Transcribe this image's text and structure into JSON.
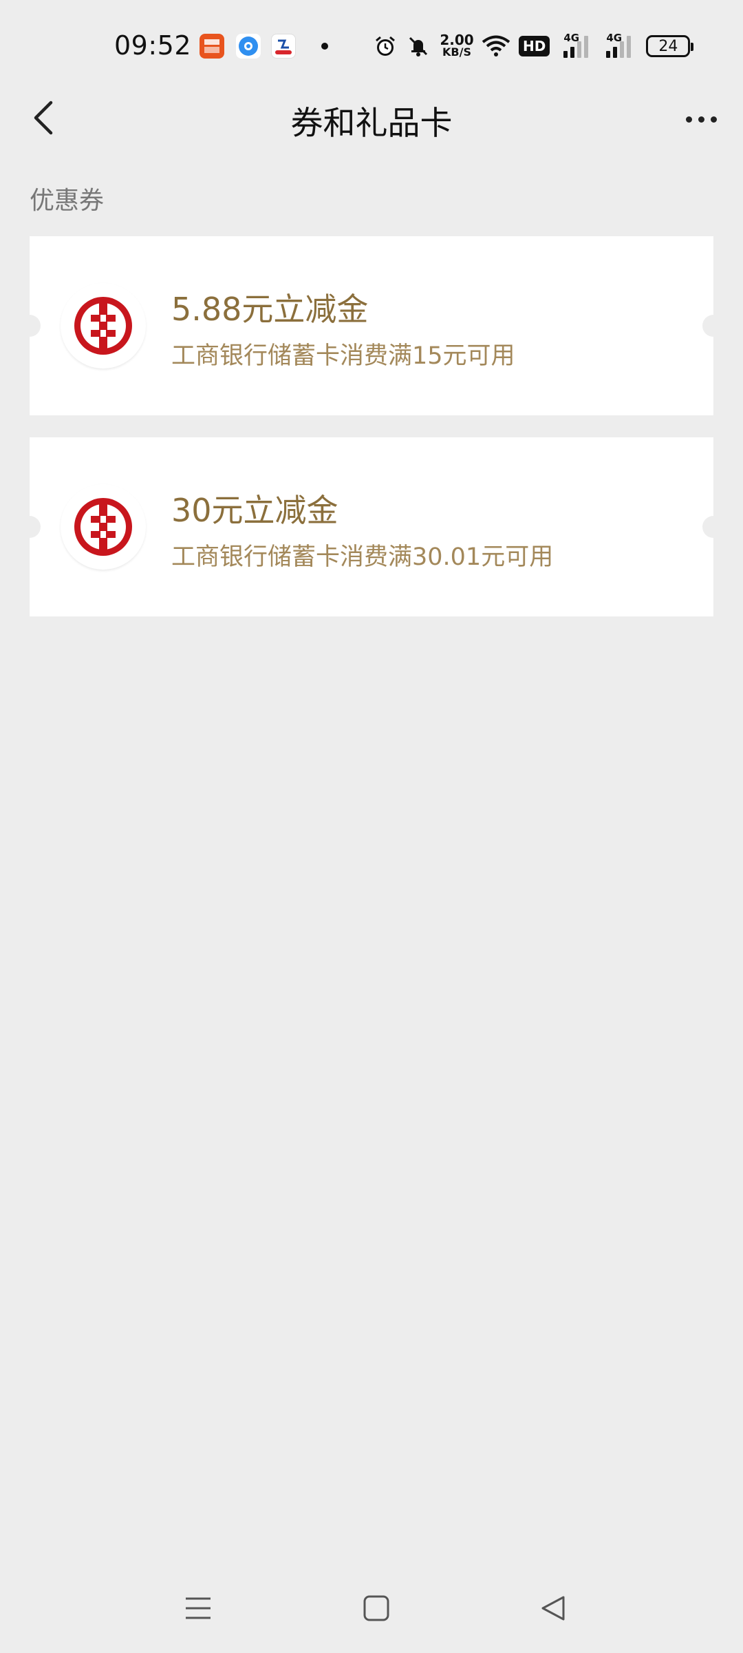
{
  "status_bar": {
    "time": "09:52",
    "net_speed_value": "2.00",
    "net_speed_unit": "KB/S",
    "hd_label": "HD",
    "network_1": "4G",
    "network_2": "4G",
    "battery_level": "24",
    "notification_icons": [
      "ping-an-bank-icon",
      "blue-circle-app-icon",
      "bank-app-icon"
    ]
  },
  "navbar": {
    "title": "券和礼品卡"
  },
  "section": {
    "label": "优惠券"
  },
  "coupons": [
    {
      "title": "5.88元立减金",
      "description": "工商银行储蓄卡消费满15元可用",
      "logo": "icbc-logo-icon"
    },
    {
      "title": "30元立减金",
      "description": "工商银行储蓄卡消费满30.01元可用",
      "logo": "icbc-logo-icon"
    }
  ],
  "colors": {
    "background": "#ededed",
    "coupon_title": "#8b6f3c",
    "coupon_desc": "#a3885a",
    "icbc_red": "#c8161d"
  }
}
